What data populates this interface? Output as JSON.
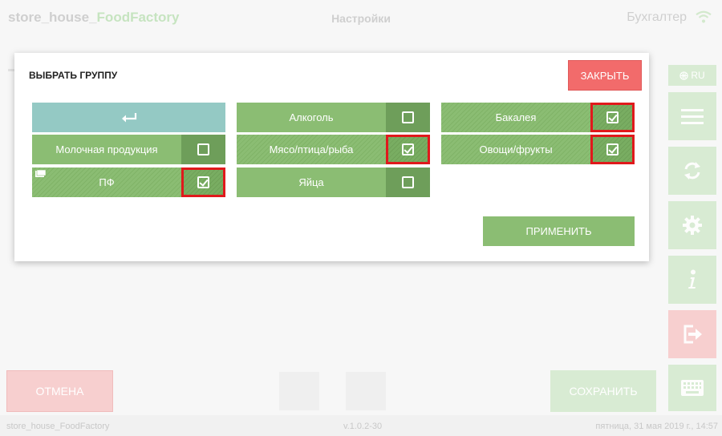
{
  "topbar": {
    "app_name_prefix": "store_house_",
    "app_name_brand": "FoodFactory",
    "page_title": "Настройки",
    "user": "Бухгалтер"
  },
  "rail": {
    "lang": "RU",
    "icons": [
      "menu-icon",
      "sync-icon",
      "gear-icon",
      "info-icon",
      "exit-icon",
      "keyboard-icon"
    ]
  },
  "modal": {
    "title": "ВЫБРАТЬ ГРУППУ",
    "close_label": "ЗАКРЫТЬ",
    "apply_label": "ПРИМЕНИТЬ",
    "groups": [
      {
        "label": "Молочная продукция",
        "checked": false
      },
      {
        "label": "ПФ",
        "checked": true,
        "has_folder": true
      },
      {
        "label": "Алкоголь",
        "checked": false
      },
      {
        "label": "Мясо/птица/рыба",
        "checked": true
      },
      {
        "label": "Яйца",
        "checked": false
      },
      {
        "label": "Бакалея",
        "checked": true
      },
      {
        "label": "Овощи/фрукты",
        "checked": true
      }
    ]
  },
  "bottom": {
    "cancel_label": "ОТМЕНА",
    "save_label": "СОХРАНИТЬ"
  },
  "footer": {
    "app": "store_house_FoodFactory",
    "version": "v.1.0.2-30",
    "datetime": "пятница, 31 мая 2019 г., 14:57"
  },
  "colors": {
    "accent_green": "#8bbd73",
    "close_red": "#f26b6b",
    "highlight_red": "#e0191c",
    "back_teal": "#94c9c4"
  }
}
